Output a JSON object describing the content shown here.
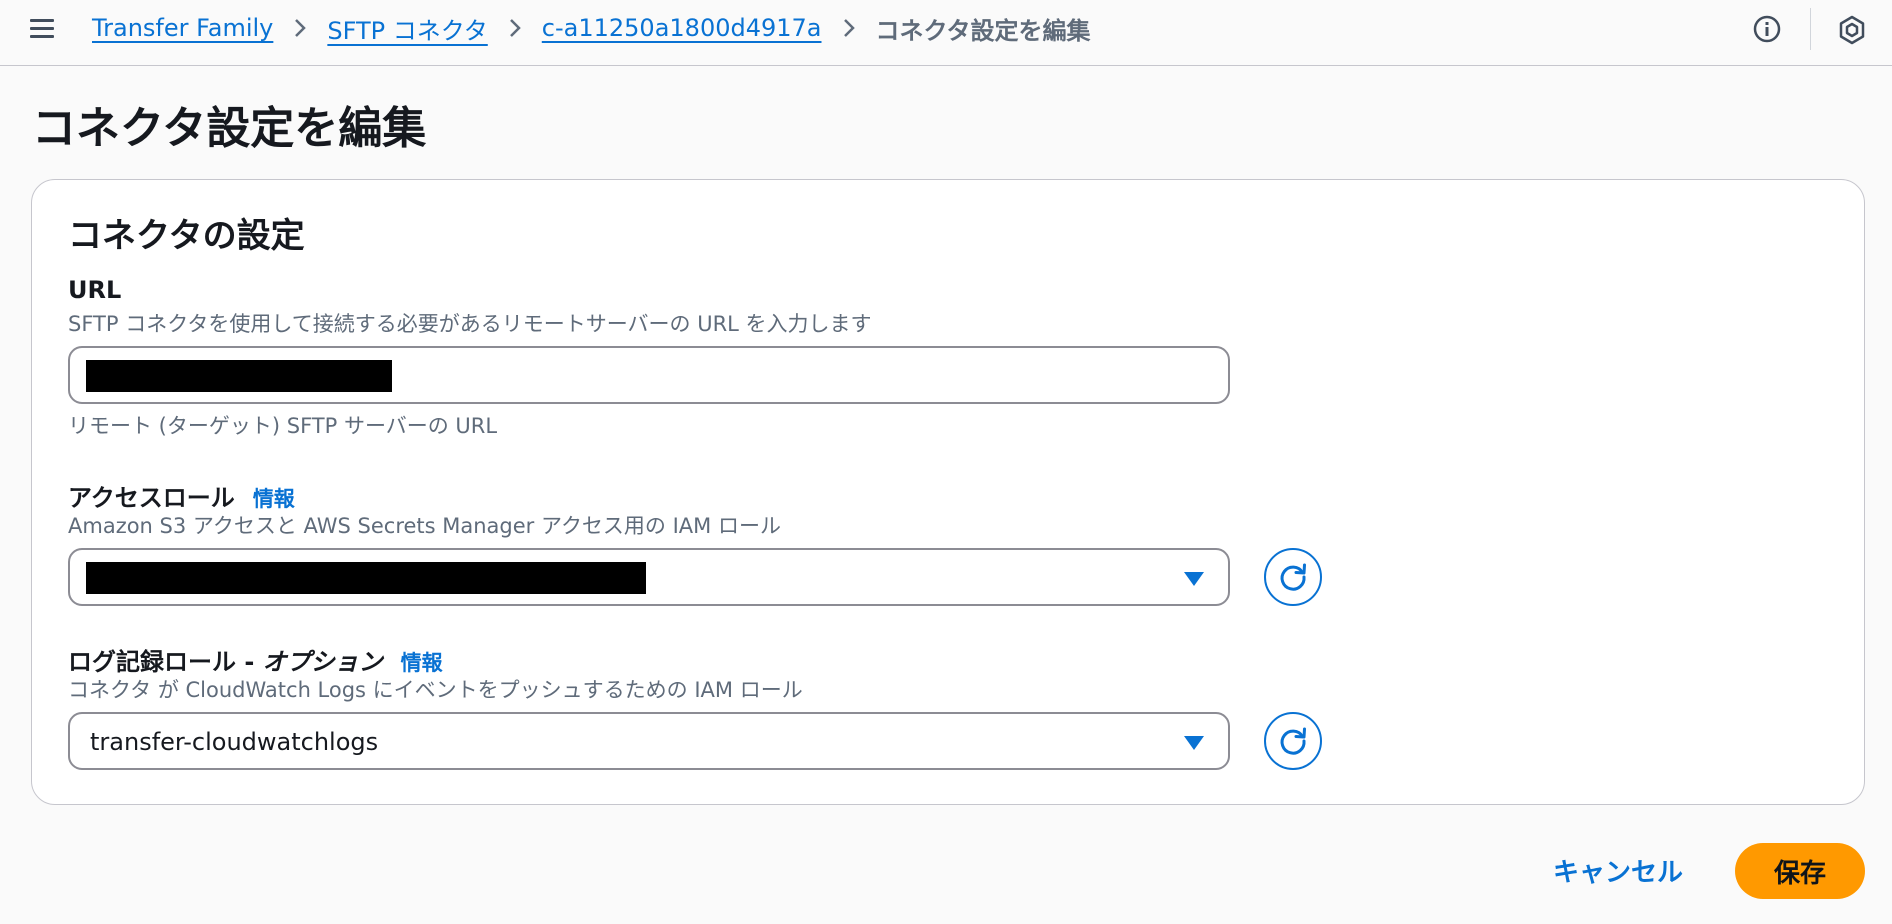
{
  "breadcrumbs": [
    {
      "label": "Transfer Family"
    },
    {
      "label": "SFTP コネクタ"
    },
    {
      "label": "c-a11250a1800d4917a"
    },
    {
      "label": "コネクタ設定を編集"
    }
  ],
  "page": {
    "title": "コネクタ設定を編集"
  },
  "card": {
    "title": "コネクタの設定",
    "url": {
      "label": "URL",
      "description": "SFTP コネクタを使用して接続する必要があるリモートサーバーの URL を入力します",
      "value": "",
      "constraint": "リモート (ターゲット) SFTP サーバーの URL"
    },
    "access_role": {
      "label": "アクセスロール",
      "info": "情報",
      "description": "Amazon S3 アクセスと AWS Secrets Manager アクセス用の IAM ロール",
      "value": ""
    },
    "logging_role": {
      "label": "ログ記録ロール",
      "label_sep": " - ",
      "label_optional": "オプション",
      "info": "情報",
      "description": "コネクタ が CloudWatch Logs にイベントをプッシュするための IAM ロール",
      "value": "transfer-cloudwatchlogs"
    }
  },
  "actions": {
    "cancel": "キャンセル",
    "save": "保存"
  },
  "icons": {
    "menu": "hamburger-menu-icon",
    "info": "info-circle-icon",
    "cube": "cube-icon",
    "refresh": "refresh-icon",
    "dropdown": "caret-down-icon",
    "separator": "chevron-right-icon"
  },
  "colors": {
    "link": "#0972d3",
    "primary_button": "#ff9900",
    "text": "#16191f",
    "secondary_text": "#5f6b7a",
    "border": "#c6c6cd"
  }
}
